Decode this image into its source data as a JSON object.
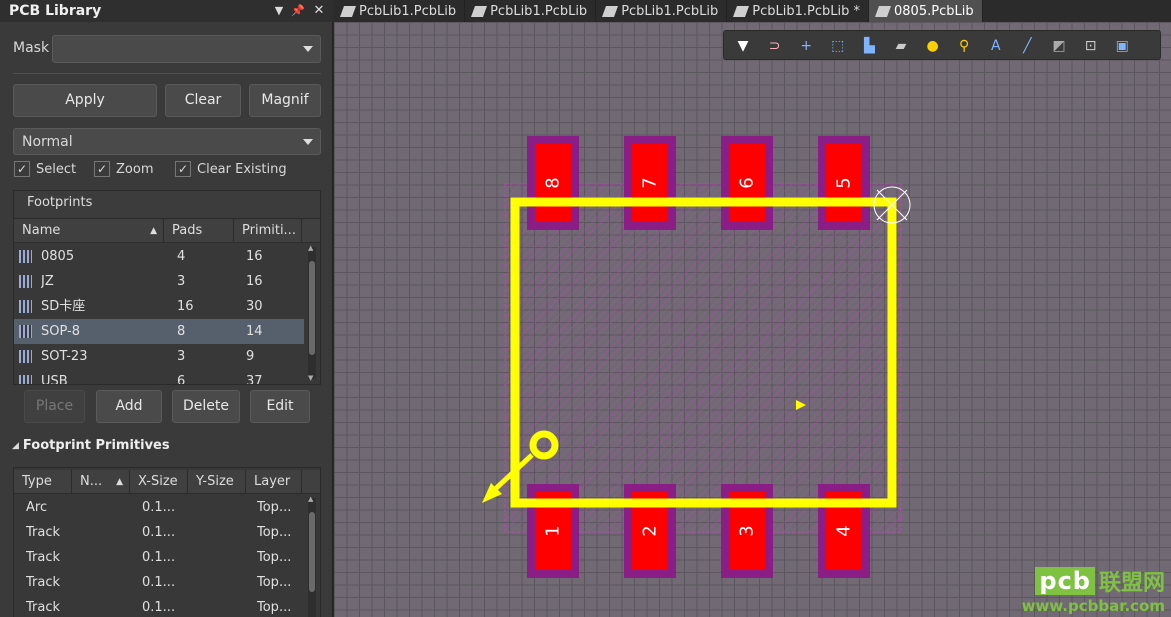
{
  "panel": {
    "title": "PCB Library",
    "mask_label": "Mask",
    "mask_value": "",
    "buttons": {
      "apply": "Apply",
      "clear": "Clear",
      "magnify": "Magnif"
    },
    "mode_value": "Normal",
    "checks": {
      "select": "Select",
      "zoom": "Zoom",
      "clear_existing": "Clear Existing"
    },
    "footprints": {
      "title": "Footprints",
      "columns": [
        "Name",
        "Pads",
        "Primiti..."
      ],
      "rows": [
        {
          "name": "0805",
          "pads": "4",
          "prims": "16"
        },
        {
          "name": "JZ",
          "pads": "3",
          "prims": "16"
        },
        {
          "name": "SD卡座",
          "pads": "16",
          "prims": "30"
        },
        {
          "name": "SOP-8",
          "pads": "8",
          "prims": "14"
        },
        {
          "name": "SOT-23",
          "pads": "3",
          "prims": "9"
        },
        {
          "name": "USB",
          "pads": "6",
          "prims": "37"
        }
      ],
      "selected_index": 3
    },
    "fp_buttons": {
      "place": "Place",
      "add": "Add",
      "delete": "Delete",
      "edit": "Edit"
    },
    "primitives": {
      "title": "Footprint Primitives",
      "columns": [
        "Type",
        "N...",
        "X-Size",
        "Y-Size",
        "Layer"
      ],
      "rows": [
        {
          "type": "Arc",
          "x": "0.1...",
          "layer": "Top..."
        },
        {
          "type": "Track",
          "x": "0.1...",
          "layer": "Top..."
        },
        {
          "type": "Track",
          "x": "0.1...",
          "layer": "Top..."
        },
        {
          "type": "Track",
          "x": "0.1...",
          "layer": "Top..."
        },
        {
          "type": "Track",
          "x": "0.1...",
          "layer": "Top..."
        }
      ]
    }
  },
  "tabs": [
    {
      "label": "PcbLib1.PcbLib",
      "active": false
    },
    {
      "label": "PcbLib1.PcbLib",
      "active": false
    },
    {
      "label": "PcbLib1.PcbLib",
      "active": false
    },
    {
      "label": "PcbLib1.PcbLib *",
      "active": false
    },
    {
      "label": "0805.PcbLib",
      "active": true
    }
  ],
  "toolbar_icons": [
    "filter-icon",
    "route-icon",
    "crosshair-icon",
    "select-rect-icon",
    "align-icon",
    "component-icon",
    "via-icon",
    "pad-icon",
    "text-icon",
    "line-icon",
    "polygon-icon",
    "dimension-icon",
    "board-icon"
  ],
  "pads_top": [
    "8",
    "7",
    "6",
    "5"
  ],
  "pads_bottom": [
    "1",
    "2",
    "3",
    "4"
  ],
  "colors": {
    "pad": "#ff0000",
    "pad_mask": "#8a1e86",
    "silk": "#ffff00",
    "courtyard": "#c040c0"
  },
  "watermark": {
    "brand": "pcb",
    "cn": "联盟网",
    "url": "www.pcbbar.com"
  }
}
